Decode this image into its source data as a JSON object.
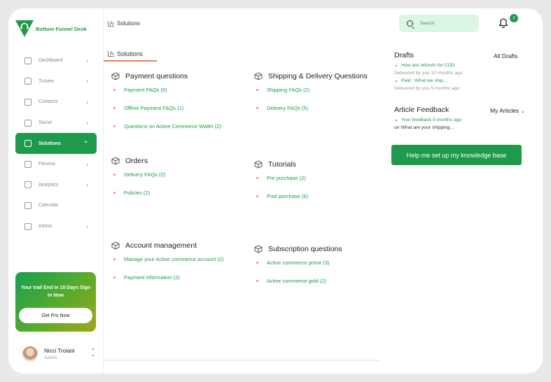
{
  "brand": {
    "name": "Bottom Funnel Desk",
    "color": "#1f9a4c"
  },
  "sidebar": {
    "items": [
      {
        "label": "Dashboard",
        "icon": "dashboard-icon",
        "chevron": true
      },
      {
        "label": "Tickets",
        "icon": "ticket-icon",
        "chevron": true
      },
      {
        "label": "Contacts",
        "icon": "contacts-icon",
        "chevron": true
      },
      {
        "label": "Social",
        "icon": "social-icon",
        "chevron": true
      },
      {
        "label": "Solutions",
        "icon": "solutions-icon",
        "chevron": true,
        "active": true
      },
      {
        "label": "Forums",
        "icon": "forums-icon",
        "chevron": true
      },
      {
        "label": "Analytics",
        "icon": "analytics-icon",
        "chevron": true
      },
      {
        "label": "Calendar",
        "icon": "calendar-icon",
        "chevron": false
      },
      {
        "label": "Admin",
        "icon": "lock-icon",
        "chevron": true
      }
    ],
    "promo": {
      "text": "Your trail End in 10 Days Sign In Now",
      "button": "Get Pro Now"
    },
    "user": {
      "name": "Nicci Troiani",
      "role": "Admin"
    }
  },
  "header": {
    "title": "Solutions",
    "search_placeholder": "Search",
    "notification_count": "2"
  },
  "tabs": [
    {
      "label": "Solutions",
      "active": true
    }
  ],
  "categories": [
    {
      "title": "Payment questions",
      "items": [
        "Payment FAQs (5)",
        "Offline Payment FAQs (1)",
        "Questions on Active Commerce Wallet (2)"
      ]
    },
    {
      "title": "Shipping & Delivery Questions",
      "items": [
        "Shipping FAQs (2)",
        "Delivery FAQs (5)"
      ]
    },
    {
      "title": "Orders",
      "items": [
        "Delivery FAQs (2)",
        "Policies (2)"
      ]
    },
    {
      "title": "Tutorials",
      "items": [
        "Pre purchase (2)",
        "Post purchase (6)"
      ]
    },
    {
      "title": "Account management",
      "items": [
        "Manage your Active commerce account  (2)",
        "Payment information (2)"
      ]
    },
    {
      "title": "Subscription questions",
      "items": [
        "Active commerce prime (3)",
        "Active commerce gold (2)"
      ]
    }
  ],
  "right_panel": {
    "drafts": {
      "title": "Drafts",
      "link": "All Drafts",
      "items": [
        {
          "title": "How are refunds for COD",
          "meta": "Delivered by you 10 months ago"
        },
        {
          "title": "Paid : What we ship....",
          "meta": "Delivered by you 5 months ago"
        }
      ]
    },
    "feedback": {
      "title": "Article Feedback",
      "link": "My Articles",
      "items": [
        {
          "title": "Your feedback 5 months ago",
          "meta": "on What are your shipping..."
        }
      ]
    },
    "kb_button": "Help me set up my knowledge base"
  }
}
